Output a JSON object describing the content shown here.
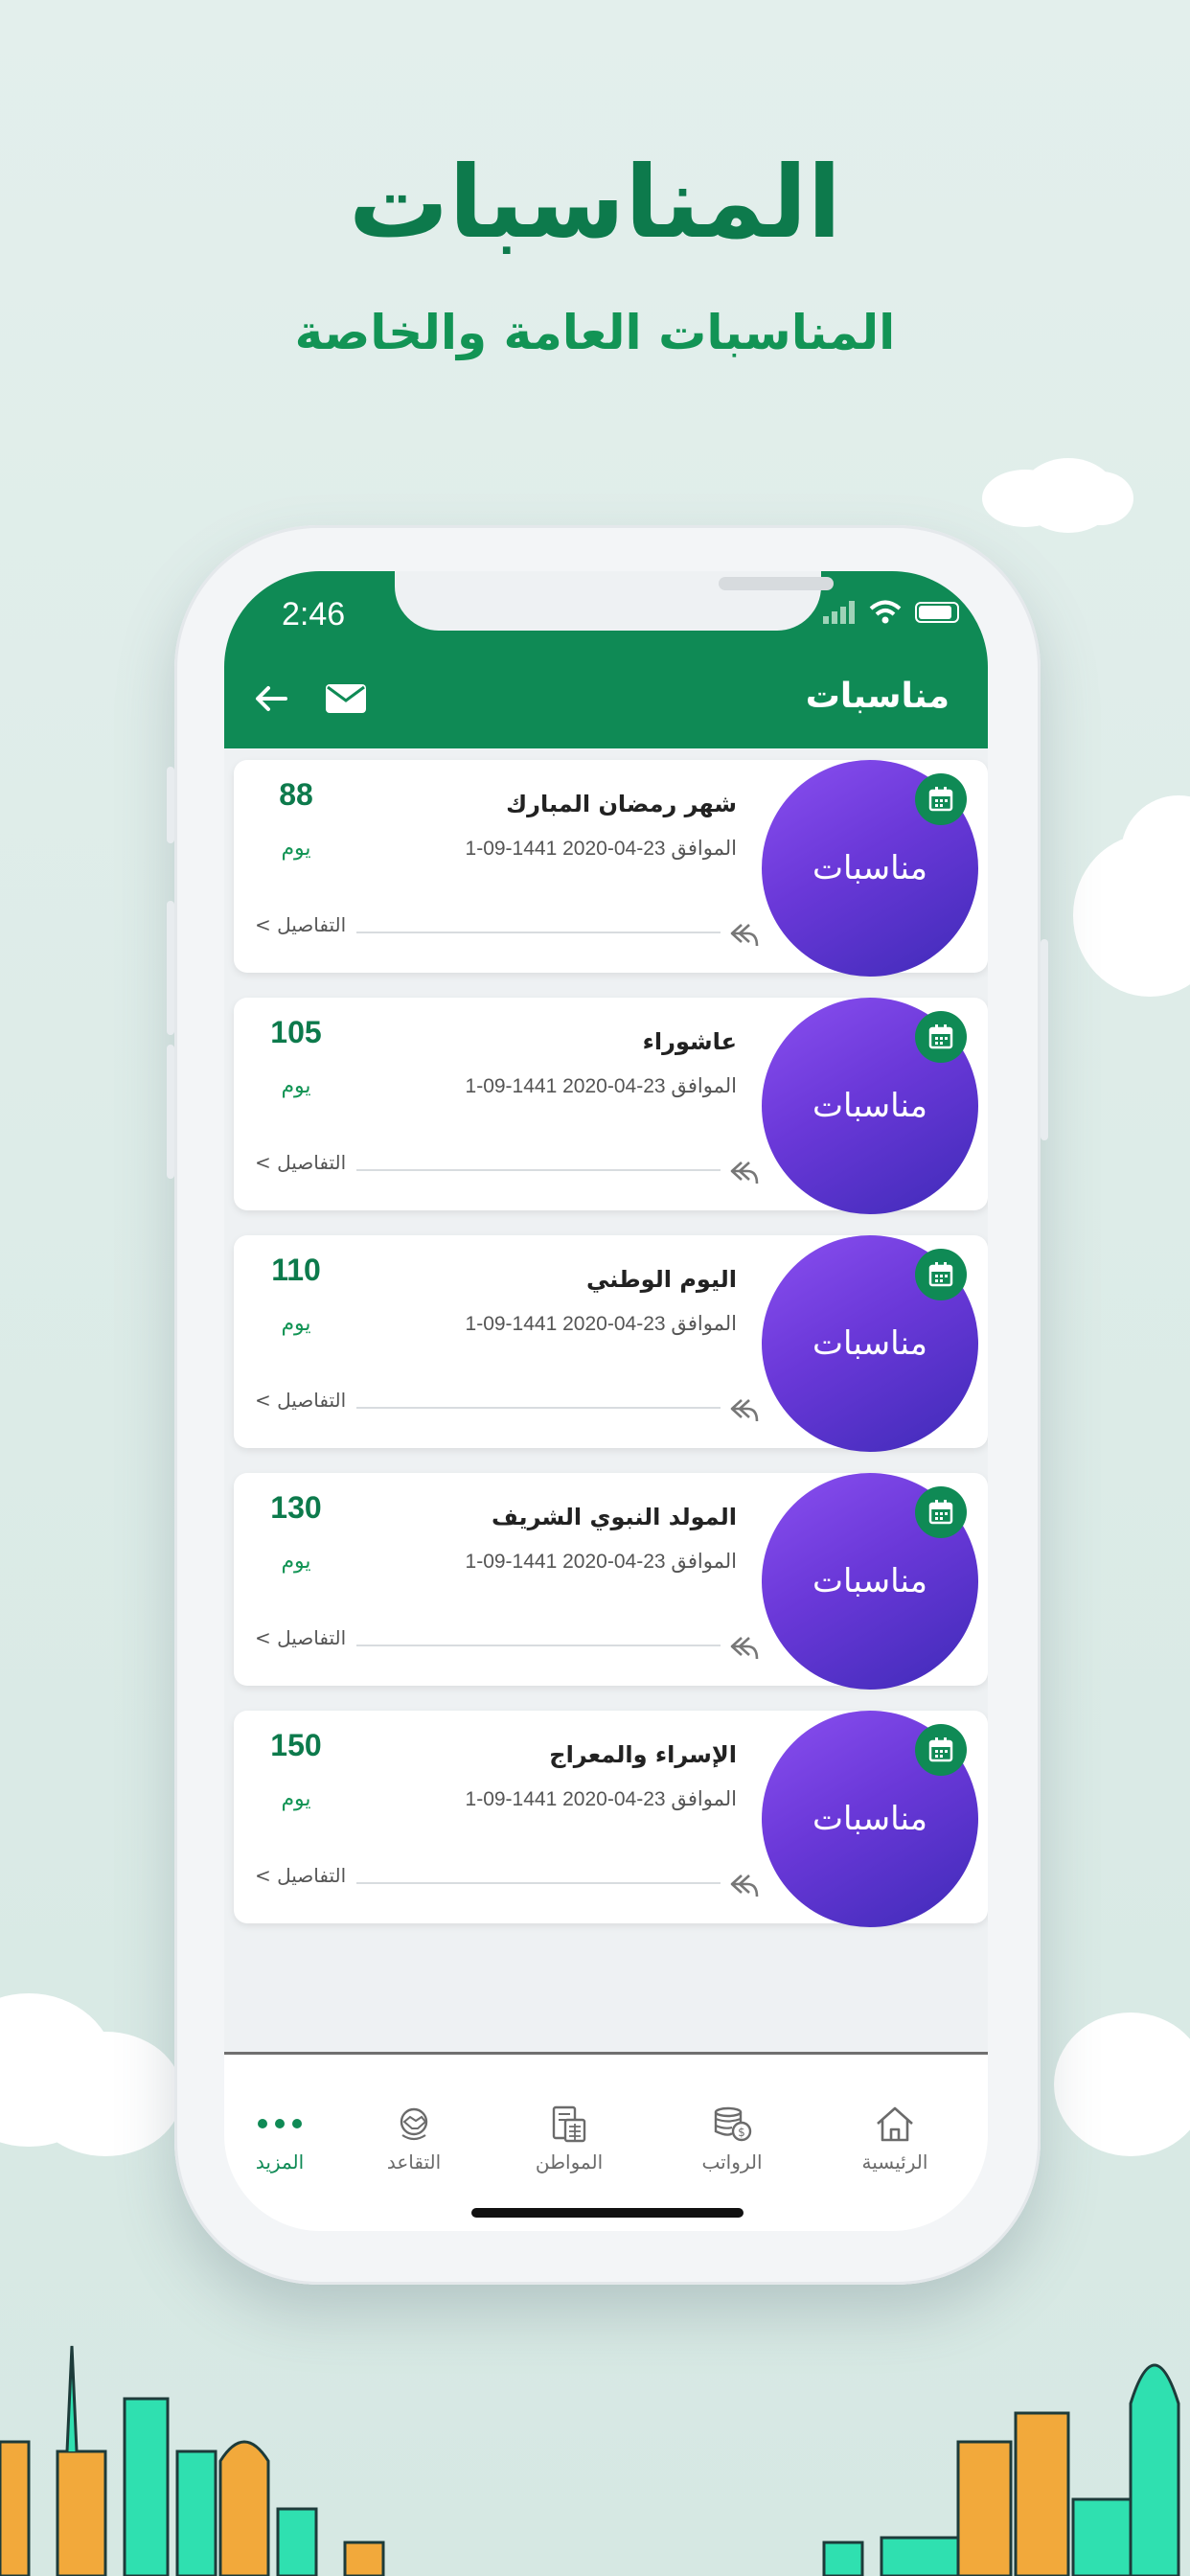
{
  "promo": {
    "title": "المناسبات",
    "subtitle": "المناسبات العامة والخاصة"
  },
  "status_bar": {
    "time": "2:46"
  },
  "header": {
    "title": "مناسبات",
    "back_icon": "arrow-left-icon",
    "mail_icon": "envelope-icon"
  },
  "occasions": [
    {
      "title": "شهر رمضان المبارك",
      "date": "1-09-1441 الموافق 23-04-2020",
      "days": "88",
      "unit": "يوم",
      "badge": "مناسبات",
      "details": "التفاصيل >"
    },
    {
      "title": "عاشوراء",
      "date": "1-09-1441 الموافق 23-04-2020",
      "days": "105",
      "unit": "يوم",
      "badge": "مناسبات",
      "details": "التفاصيل >"
    },
    {
      "title": "اليوم الوطني",
      "date": "1-09-1441 الموافق 23-04-2020",
      "days": "110",
      "unit": "يوم",
      "badge": "مناسبات",
      "details": "التفاصيل >"
    },
    {
      "title": "المولد النبوي الشريف",
      "date": "1-09-1441 الموافق 23-04-2020",
      "days": "130",
      "unit": "يوم",
      "badge": "مناسبات",
      "details": "التفاصيل >"
    },
    {
      "title": "الإسراء والمعراج",
      "date": "1-09-1441 الموافق 23-04-2020",
      "days": "150",
      "unit": "يوم",
      "badge": "مناسبات",
      "details": "التفاصيل >"
    }
  ],
  "tabbar": [
    {
      "label": "الرئيسية",
      "icon": "home-icon",
      "active": false
    },
    {
      "label": "الرواتب",
      "icon": "coins-icon",
      "active": false
    },
    {
      "label": "المواطن",
      "icon": "document-icon",
      "active": false
    },
    {
      "label": "التقاعد",
      "icon": "handshake-icon",
      "active": false
    },
    {
      "label": "المزيد",
      "icon": "more-dots-icon",
      "active": true
    }
  ],
  "colors": {
    "brand_green": "#0f8a55",
    "title_green": "#0d7a4c",
    "circle_purple_start": "#8a4ff0",
    "circle_purple_end": "#3f2bb8"
  }
}
